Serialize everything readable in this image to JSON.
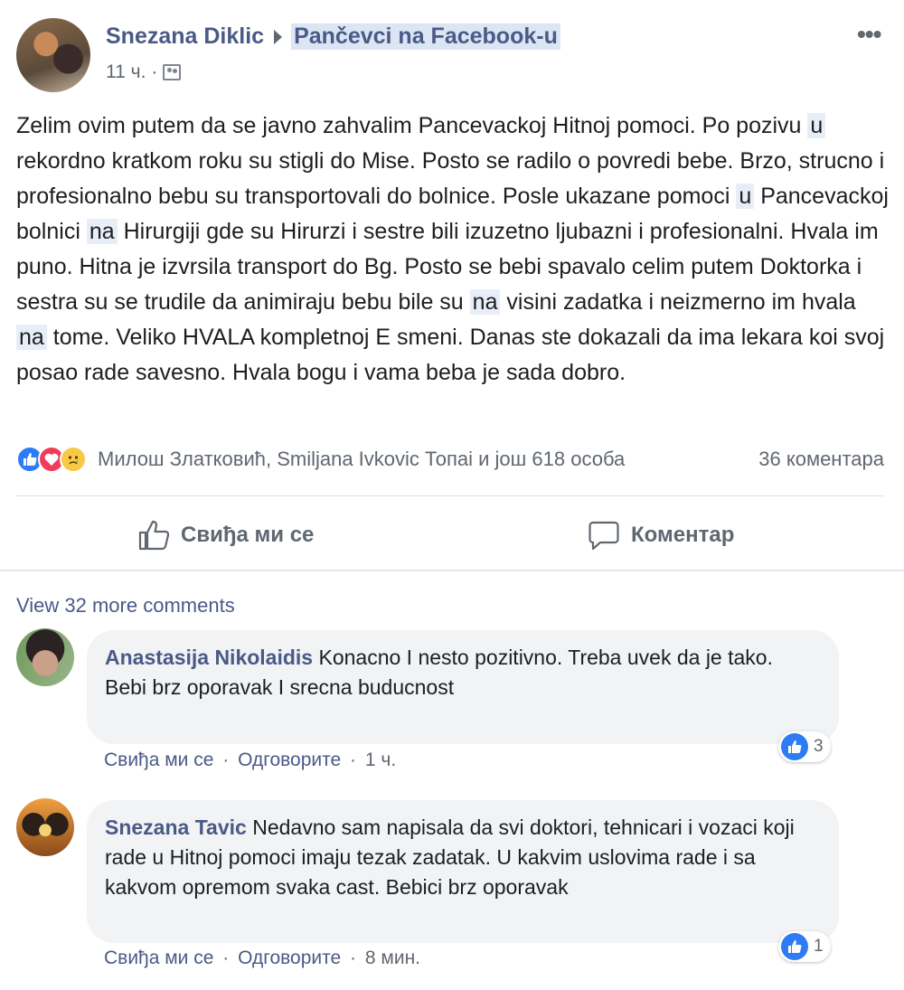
{
  "post": {
    "author": "Snezana Diklic",
    "group": "Pančevci na Facebook-u",
    "time": "11 ч.",
    "dot": "·",
    "more": "•••",
    "body": [
      {
        "t": "Zelim ovim putem da se javno zahvalim Pancevackoj Hitnoj pomoci. Po pozivu "
      },
      {
        "t": "u",
        "hl": true
      },
      {
        "t": " rekordno kratkom roku su stigli do Mise. Posto se radilo o povredi bebe. Brzo, strucno i profesionalno bebu su transportovali do bolnice. Posle ukazane pomoci "
      },
      {
        "t": "u",
        "hl": true
      },
      {
        "t": " Pancevackoj bolnici "
      },
      {
        "t": "na",
        "hl": true
      },
      {
        "t": " Hirurgiji gde su Hirurzi i sestre bili izuzetno ljubazni i profesionalni. Hvala im puno. Hitna je izvrsila transport do Bg. Posto se bebi spavalo celim putem Doktorka i sestra su se trudile da animiraju bebu bile su "
      },
      {
        "t": "na",
        "hl": true
      },
      {
        "t": " visini zadatka i neizmerno im hvala "
      },
      {
        "t": "na",
        "hl": true
      },
      {
        "t": " tome. Veliko HVALA kompletnoj E smeni. Danas ste dokazali da ima lekara koi svoj posao rade savesno. Hvala bogu i vama beba je sada dobro."
      }
    ],
    "reactions_text": "Милош Златковић, Smiljana Ivkovic Топаі и још 618 особа",
    "comments_count": "36 коментара"
  },
  "actions": {
    "like": "Свиђа ми се",
    "comment": "Коментар"
  },
  "view_more": "View 32 more comments",
  "comments": [
    {
      "author": "Anastasija Nikolaidis",
      "text": "Konacno I nesto pozitivno. Treba uvek da je tako.",
      "text2": "Bebi brz oporavak I srecna buducnost",
      "like": "Свиђа ми се",
      "reply": "Одговорите",
      "time": "1 ч.",
      "likes": "3"
    },
    {
      "author": "Snezana Tavic",
      "text": "Nedavno sam napisala da svi doktori, tehnicari i vozaci koji rade u Hitnoj pomoci imaju tezak zadatak. U kakvim uslovima rade i sa kakvom opremom svaka cast. Bebici brz oporavak",
      "like": "Свиђа ми се",
      "reply": "Одговорите",
      "time": "8 мин.",
      "likes": "1"
    }
  ],
  "colors": {
    "link": "#4a5a87",
    "like_blue": "#2d7cf6",
    "love_red": "#ef3c58",
    "bubble": "#f2f3f5"
  }
}
